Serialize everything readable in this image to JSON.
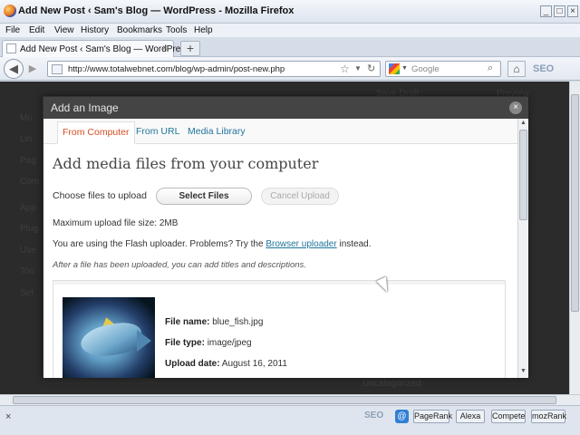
{
  "window": {
    "title": "Add New Post ‹ Sam's Blog — WordPress - Mozilla Firefox"
  },
  "menubar": {
    "items": [
      "File",
      "Edit",
      "View",
      "History",
      "Bookmarks",
      "Tools",
      "Help"
    ]
  },
  "tab": {
    "label": "Add New Post ‹ Sam's Blog — WordPress",
    "close": "×",
    "new_tab": "+"
  },
  "nav": {
    "url": "http://www.totalwebnet.com/blog/wp-admin/post-new.php",
    "search_placeholder": "Google",
    "seo_label": "SEO"
  },
  "background_page": {
    "sidebar_items": [
      "Mo",
      "Lin",
      "Pag",
      "Com",
      "App",
      "Plug",
      "Use",
      "Too",
      "Set"
    ],
    "right_texts": [
      "Save Draft",
      "Preview"
    ],
    "bottom_text": "Uncategorized"
  },
  "modal": {
    "title": "Add an Image",
    "close": "×",
    "tabs": [
      "From Computer",
      "From URL",
      "Media Library"
    ],
    "heading": "Add media files from your computer",
    "choose_label": "Choose files to upload",
    "select_button": "Select Files",
    "cancel_button": "Cancel Upload",
    "max_size": "Maximum upload file size: 2MB",
    "flash_prefix": "You are using the Flash uploader.  Problems?  Try the ",
    "flash_link": "Browser uploader",
    "flash_suffix": " instead.",
    "after_upload": "After a file has been uploaded, you can add titles and descriptions.",
    "file": {
      "name_label": "File name:",
      "name_value": "blue_fish.jpg",
      "type_label": "File type:",
      "type_value": "image/jpeg",
      "date_label": "Upload date:",
      "date_value": "August 16, 2011"
    }
  },
  "statusbar": {
    "close": "×",
    "seo": "SEO",
    "addons": [
      "PageRank",
      "Alexa",
      "Compete",
      "mozRank"
    ]
  }
}
